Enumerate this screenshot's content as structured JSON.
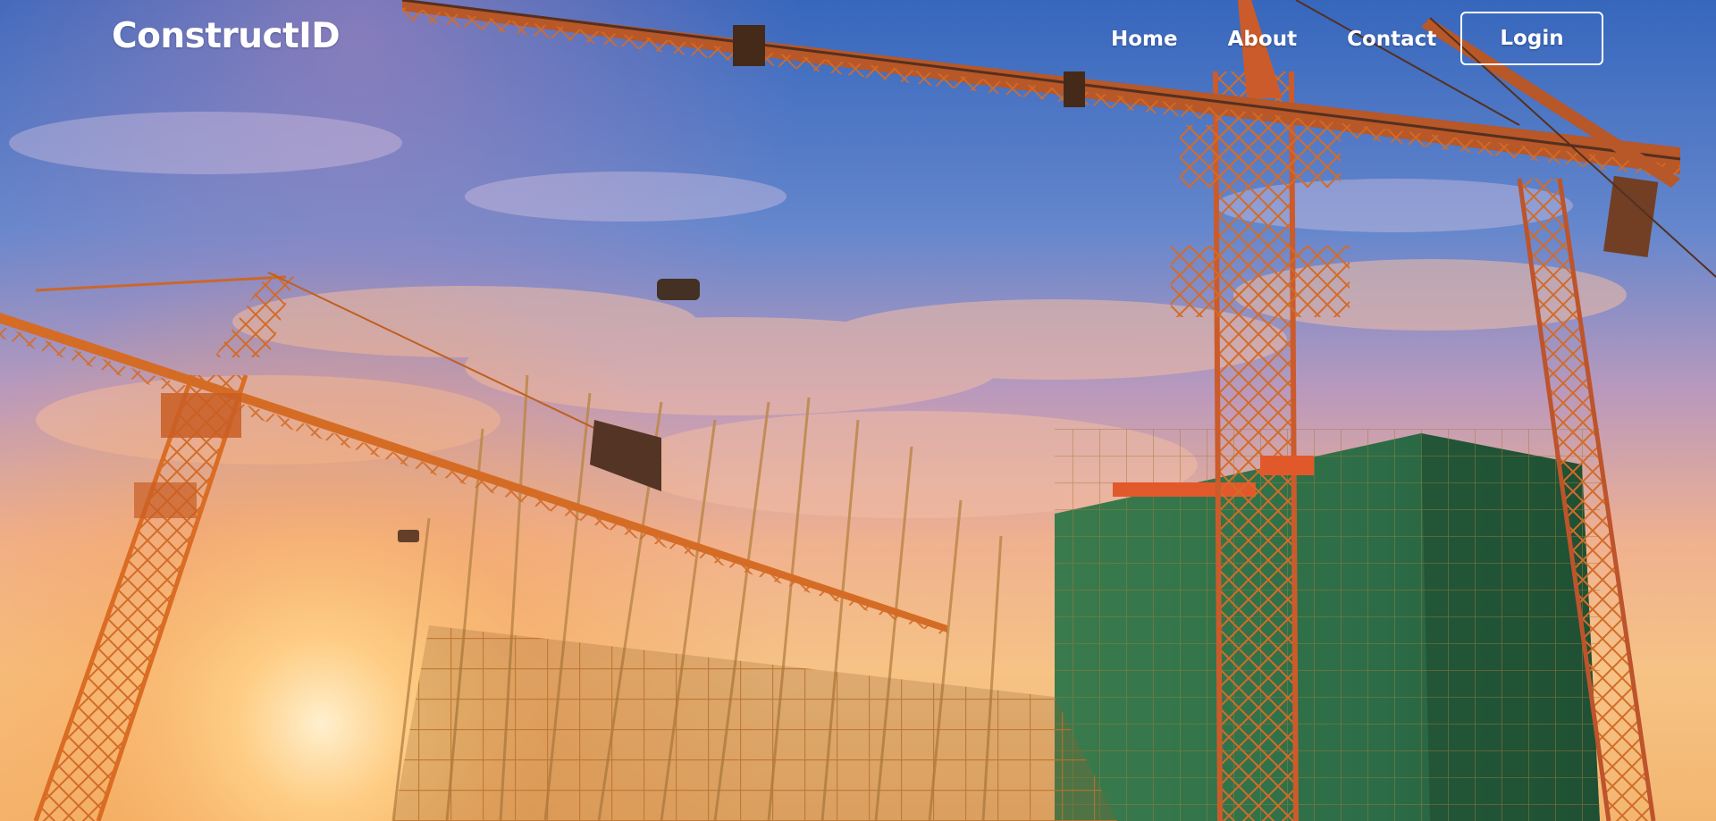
{
  "brand": {
    "name": "ConstructID"
  },
  "nav": {
    "links": [
      {
        "label": "Home"
      },
      {
        "label": "About"
      },
      {
        "label": "Contact"
      }
    ],
    "login_label": "Login"
  },
  "hero": {
    "image_icon": "construction-site-image",
    "colors": {
      "sky_top": "#2f6fc9",
      "sky_mid": "#6f8fd8",
      "glow": "#f7b25a",
      "crane": "#c85a1e",
      "scaffold_green": "#1e6b4a"
    }
  }
}
